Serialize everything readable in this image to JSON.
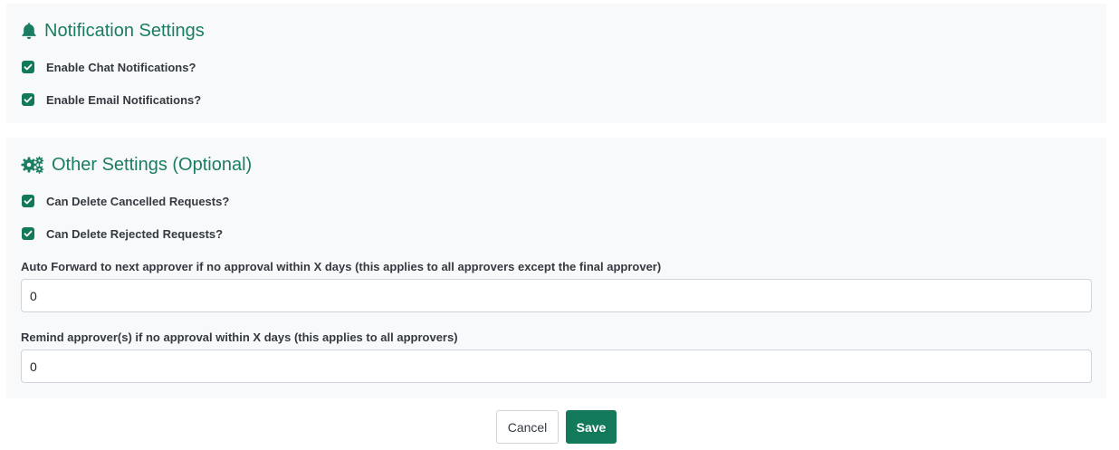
{
  "colors": {
    "accent": "#13795b",
    "title": "#1a7d63",
    "panel_bg": "#f8f9fa"
  },
  "notification_settings": {
    "title": "Notification Settings",
    "icon": "bell-icon",
    "options": [
      {
        "label": "Enable Chat Notifications?",
        "checked": true
      },
      {
        "label": "Enable Email Notifications?",
        "checked": true
      }
    ]
  },
  "other_settings": {
    "title": "Other Settings (Optional)",
    "icon": "gears-icon",
    "options": [
      {
        "label": "Can Delete Cancelled Requests?",
        "checked": true
      },
      {
        "label": "Can Delete Rejected Requests?",
        "checked": true
      }
    ],
    "auto_forward": {
      "label": "Auto Forward to next approver if no approval within X days (this applies to all approvers except the final approver)",
      "value": "0"
    },
    "remind": {
      "label": "Remind approver(s) if no approval within X days (this applies to all approvers)",
      "value": "0"
    }
  },
  "actions": {
    "cancel_label": "Cancel",
    "save_label": "Save"
  }
}
